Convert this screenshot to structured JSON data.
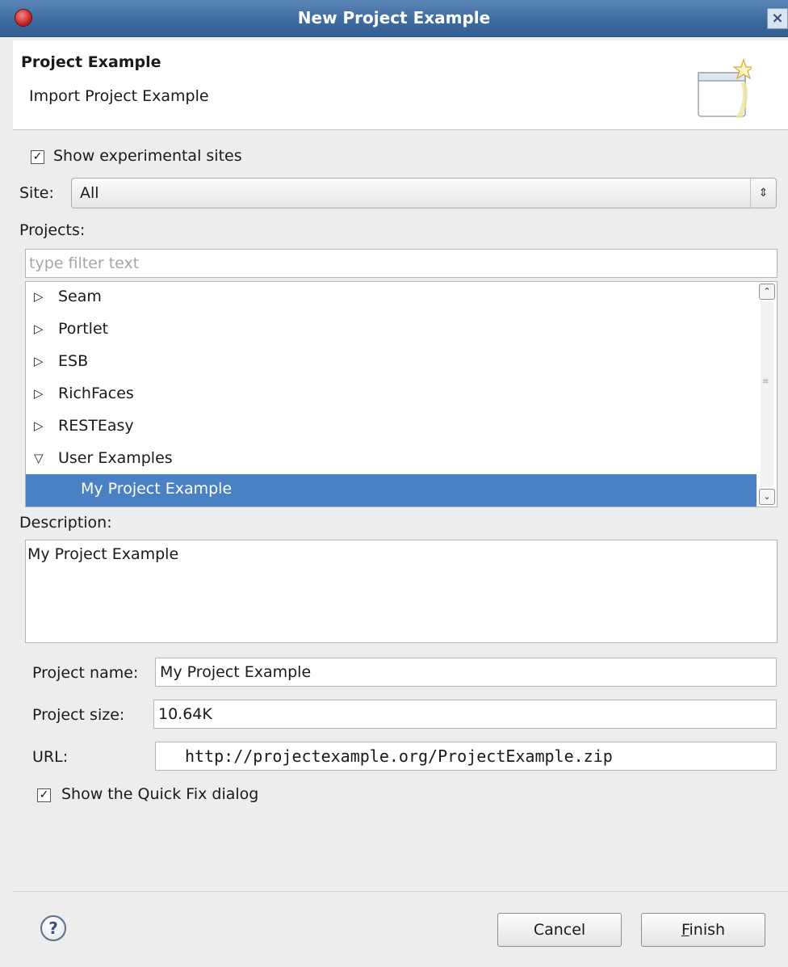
{
  "window": {
    "title": "New Project Example",
    "close_label": "×"
  },
  "header": {
    "title": "Project Example",
    "subtitle": "Import Project Example",
    "icon": "wizard-banner-icon"
  },
  "options": {
    "show_experimental_sites": {
      "label": "Show experimental sites",
      "checked": true
    },
    "site_label": "Site:",
    "site_value": "All",
    "projects_label": "Projects:",
    "filter_placeholder": "type filter text"
  },
  "tree": [
    {
      "label": "Seam",
      "expanded": false
    },
    {
      "label": "Portlet",
      "expanded": false
    },
    {
      "label": "ESB",
      "expanded": false
    },
    {
      "label": "RichFaces",
      "expanded": false
    },
    {
      "label": "RESTEasy",
      "expanded": false
    },
    {
      "label": "User Examples",
      "expanded": true
    },
    {
      "label": "My Project Example",
      "selected": true
    }
  ],
  "description": {
    "label": "Description:",
    "text": "My Project Example"
  },
  "details": {
    "name_label": "Project name:",
    "name_value": "My Project Example",
    "size_label": "Project size:",
    "size_value": "10.64K",
    "url_label": "URL:",
    "url_value": "http://projectexample.org/ProjectExample.zip"
  },
  "quick_fix": {
    "label": "Show the Quick Fix dialog",
    "checked": true
  },
  "buttons": {
    "help": "?",
    "cancel": "Cancel",
    "finish_mnemonic": "F",
    "finish_rest": "inish"
  },
  "colors": {
    "selection": "#4a81c4",
    "titlebar": "#3f6b9e"
  }
}
